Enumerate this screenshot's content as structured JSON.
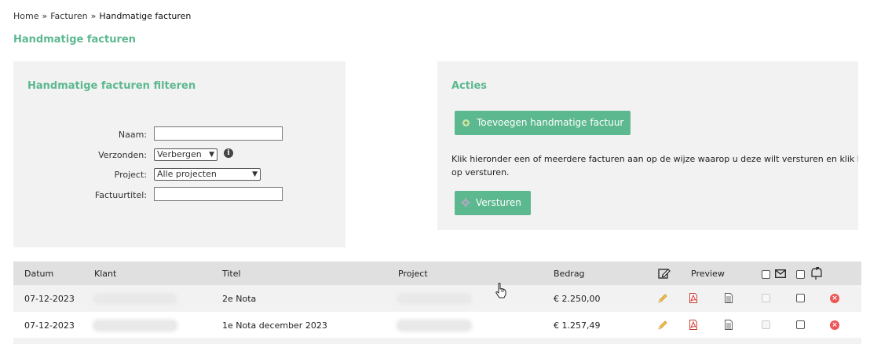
{
  "breadcrumb": {
    "home": "Home",
    "sep": "»",
    "facturen": "Facturen",
    "current": "Handmatige facturen"
  },
  "page_title": "Handmatige facturen",
  "filter": {
    "title": "Handmatige facturen filteren",
    "naam_label": "Naam:",
    "naam_value": "",
    "verzonden_label": "Verzonden:",
    "verzonden_value": "Verbergen",
    "project_label": "Project:",
    "project_value": "Alle projecten",
    "factuurtitel_label": "Factuurtitel:",
    "factuurtitel_value": ""
  },
  "actions": {
    "title": "Acties",
    "add_button": "Toevoegen handmatige factuur",
    "description": "Klik hieronder een of meerdere facturen aan op de wijze waarop u deze wilt versturen en klik hierna",
    "description2": "op versturen.",
    "send_button": "Versturen"
  },
  "table": {
    "columns": {
      "datum": "Datum",
      "klant": "Klant",
      "titel": "Titel",
      "project": "Project",
      "bedrag": "Bedrag",
      "preview": "Preview"
    },
    "rows": [
      {
        "datum": "07-12-2023",
        "titel": "2e Nota",
        "bedrag": "€ 2.250,00"
      },
      {
        "datum": "07-12-2023",
        "titel": "1e Nota december 2023",
        "bedrag": "€ 1.257,49"
      }
    ]
  },
  "colors": {
    "accent": "#5cb88f",
    "panel": "#f2f2f2",
    "header": "#e0e0e0"
  },
  "icons": [
    "info-icon",
    "plus-icon",
    "gear-icon",
    "edit-icon",
    "mail-icon",
    "mailbox-icon",
    "pencil-icon",
    "pdf-icon",
    "document-icon",
    "delete-icon",
    "cursor-icon"
  ]
}
